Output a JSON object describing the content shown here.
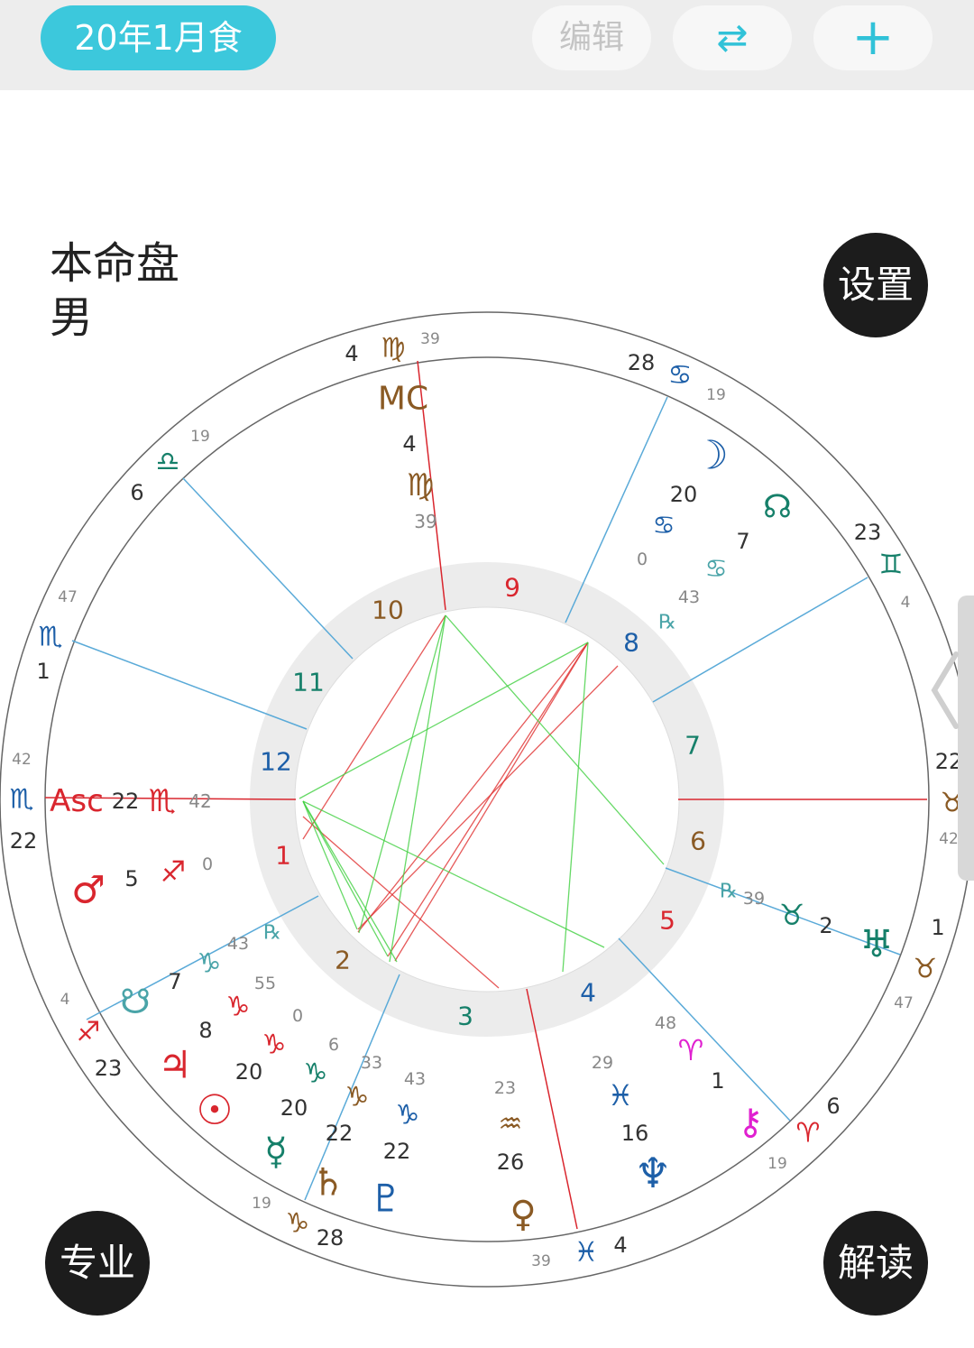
{
  "header": {
    "title": "20年1月食",
    "edit_label": "编辑",
    "swap_icon": "⇄",
    "add_icon": "+"
  },
  "chart_info": {
    "line1": "本命盘",
    "line2": "男"
  },
  "buttons": {
    "settings": "设置",
    "pro": "专业",
    "interpret": "解读"
  },
  "colors": {
    "accent": "#3cc8dc",
    "red": "#d9262e",
    "green": "#16806a",
    "blue": "#1d5fa8",
    "brown": "#8a5a24",
    "cyan": "#4aa4a8",
    "magenta": "#e020d0",
    "house_line": "#5aaad8",
    "aspect_red": "#e03030",
    "aspect_green": "#40d040"
  },
  "house_numbers": [
    "1",
    "2",
    "3",
    "4",
    "5",
    "6",
    "7",
    "8",
    "9",
    "10",
    "11",
    "12"
  ],
  "cusps": [
    {
      "deg": "4",
      "sign": "♍",
      "min": "39"
    },
    {
      "deg": "28",
      "sign": "♋",
      "min": "19"
    },
    {
      "deg": "23",
      "sign": "♊",
      "min": "4"
    },
    {
      "deg": "22",
      "sign": "♉",
      "min": "42"
    },
    {
      "deg": "1",
      "sign": "♉",
      "min": "47"
    },
    {
      "deg": "6",
      "sign": "♈",
      "min": "19"
    },
    {
      "deg": "4",
      "sign": "♓",
      "min": "39"
    },
    {
      "deg": "28",
      "sign": "♑",
      "min": "19"
    },
    {
      "deg": "23",
      "sign": "♐",
      "min": "4"
    },
    {
      "deg": "22",
      "sign": "♏",
      "min": "42"
    },
    {
      "deg": "1",
      "sign": "♏",
      "min": "47"
    },
    {
      "deg": "6",
      "sign": "♎",
      "min": "19"
    }
  ],
  "angles": {
    "mc": {
      "label": "MC",
      "deg": "4",
      "sign": "♍",
      "min": "39"
    },
    "asc": {
      "label": "Asc",
      "deg": "22",
      "sign": "♏",
      "min": "42"
    }
  },
  "planets": [
    {
      "glyph": "☽",
      "deg": "20",
      "sign": "♋",
      "min": "0"
    },
    {
      "glyph": "☊",
      "deg": "7",
      "sign": "♋",
      "min": "43",
      "rx": "℞"
    },
    {
      "glyph": "♅",
      "deg": "2",
      "sign": "♉",
      "min": "39",
      "rx": "℞"
    },
    {
      "glyph": "⚷",
      "deg": "1",
      "sign": "♈",
      "min": "48"
    },
    {
      "glyph": "♆",
      "deg": "16",
      "sign": "♓",
      "min": "29"
    },
    {
      "glyph": "♀",
      "deg": "26",
      "sign": "♒",
      "min": "23"
    },
    {
      "glyph": "♇",
      "deg": "22",
      "sign": "♑",
      "min": "43"
    },
    {
      "glyph": "♄",
      "deg": "22",
      "sign": "♑",
      "min": "33"
    },
    {
      "glyph": "☿",
      "deg": "20",
      "sign": "♑",
      "min": "6"
    },
    {
      "glyph": "☉",
      "deg": "20",
      "sign": "♑",
      "min": "0"
    },
    {
      "glyph": "♃",
      "deg": "8",
      "sign": "♑",
      "min": "55"
    },
    {
      "glyph": "☋",
      "deg": "7",
      "sign": "♑",
      "min": "43",
      "rx": "℞"
    },
    {
      "glyph": "♂",
      "deg": "5",
      "sign": "♐",
      "min": "0"
    }
  ]
}
